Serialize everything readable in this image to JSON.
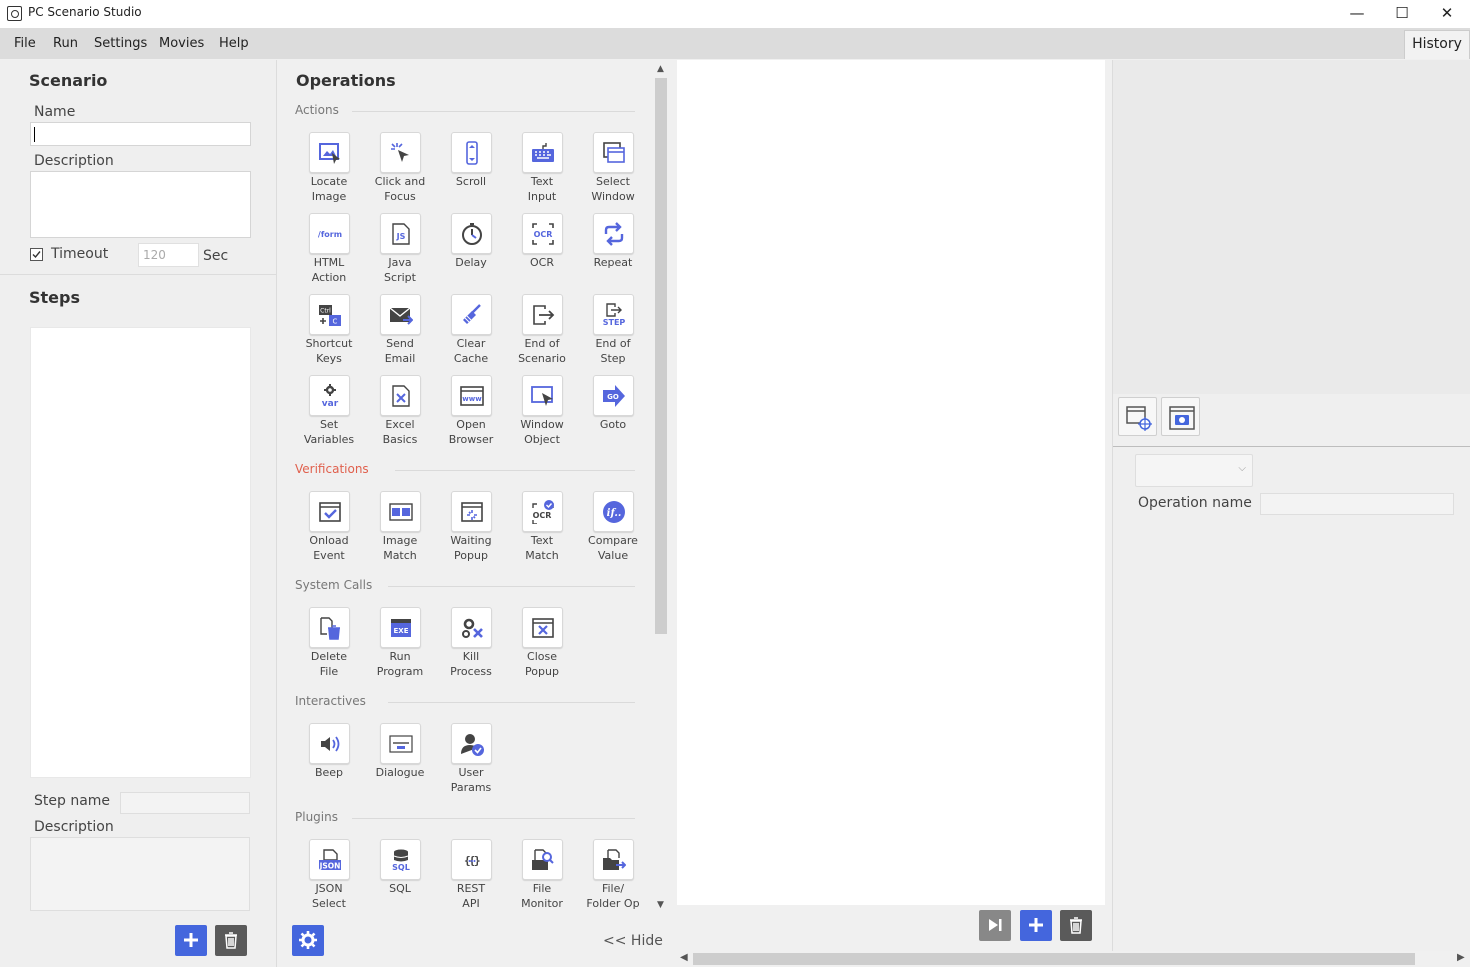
{
  "app": {
    "title": "PC Scenario Studio"
  },
  "window_controls": {
    "minimize": "—",
    "maximize": "☐",
    "close": "✕"
  },
  "menu": [
    "File",
    "Run",
    "Settings",
    "Movies",
    "Help"
  ],
  "history_tab": "History",
  "scenario": {
    "title": "Scenario",
    "name_label": "Name",
    "name_value": "",
    "description_label": "Description",
    "description_value": "",
    "timeout_label": "Timeout",
    "timeout_checked": true,
    "timeout_value": "120",
    "timeout_unit": "Sec"
  },
  "steps": {
    "title": "Steps",
    "step_name_label": "Step name",
    "step_name_value": "",
    "description_label": "Description",
    "description_value": ""
  },
  "operations": {
    "title": "Operations",
    "categories": [
      {
        "name": "Actions",
        "items": [
          {
            "label": "Locate\nImage",
            "icon": "locate-image-icon"
          },
          {
            "label": "Click and\nFocus",
            "icon": "click-focus-icon"
          },
          {
            "label": "Scroll",
            "icon": "scroll-icon"
          },
          {
            "label": "Text\nInput",
            "icon": "keyboard-icon"
          },
          {
            "label": "Select\nWindow",
            "icon": "select-window-icon"
          },
          {
            "label": "HTML\nAction",
            "icon": "html-form-icon"
          },
          {
            "label": "Java\nScript",
            "icon": "javascript-icon"
          },
          {
            "label": "Delay",
            "icon": "stopwatch-icon"
          },
          {
            "label": "OCR",
            "icon": "ocr-icon"
          },
          {
            "label": "Repeat",
            "icon": "repeat-icon"
          },
          {
            "label": "Shortcut\nKeys",
            "icon": "shortcut-keys-icon"
          },
          {
            "label": "Send\nEmail",
            "icon": "send-email-icon"
          },
          {
            "label": "Clear\nCache",
            "icon": "broom-icon"
          },
          {
            "label": "End of\nScenario",
            "icon": "exit-icon"
          },
          {
            "label": "End of\nStep",
            "icon": "end-step-icon"
          },
          {
            "label": "Set\nVariables",
            "icon": "variable-gear-icon"
          },
          {
            "label": "Excel\nBasics",
            "icon": "excel-icon"
          },
          {
            "label": "Open\nBrowser",
            "icon": "browser-www-icon"
          },
          {
            "label": "Window\nObject",
            "icon": "window-cursor-icon"
          },
          {
            "label": "Goto",
            "icon": "goto-arrow-icon"
          }
        ]
      },
      {
        "name": "Verifications",
        "items": [
          {
            "label": "Onload\nEvent",
            "icon": "onload-check-icon"
          },
          {
            "label": "Image\nMatch",
            "icon": "image-match-icon"
          },
          {
            "label": "Waiting\nPopup",
            "icon": "waiting-popup-icon"
          },
          {
            "label": "Text\nMatch",
            "icon": "ocr-check-icon"
          },
          {
            "label": "Compare\nValue",
            "icon": "compare-if-icon"
          }
        ]
      },
      {
        "name": "System Calls",
        "items": [
          {
            "label": "Delete\nFile",
            "icon": "delete-file-icon"
          },
          {
            "label": "Run\nProgram",
            "icon": "exe-icon"
          },
          {
            "label": "Kill\nProcess",
            "icon": "kill-process-icon"
          },
          {
            "label": "Close\nPopup",
            "icon": "close-popup-icon"
          }
        ]
      },
      {
        "name": "Interactives",
        "items": [
          {
            "label": "Beep",
            "icon": "speaker-icon"
          },
          {
            "label": "Dialogue",
            "icon": "dialog-box-icon"
          },
          {
            "label": "User\nParams",
            "icon": "user-check-icon"
          }
        ]
      },
      {
        "name": "Plugins",
        "items": [
          {
            "label": "JSON\nSelect",
            "icon": "json-icon"
          },
          {
            "label": "SQL",
            "icon": "database-icon"
          },
          {
            "label": "REST\nAPI",
            "icon": "rest-braces-icon"
          },
          {
            "label": "File\nMonitor",
            "icon": "file-monitor-icon"
          },
          {
            "label": "File/\nFolder Op",
            "icon": "file-folder-op-icon"
          }
        ]
      }
    ],
    "hide_label": "<< Hide"
  },
  "properties": {
    "operation_name_label": "Operation name",
    "operation_name_value": "",
    "select_value": ""
  },
  "colors": {
    "accent": "#4466dd",
    "ops_icon": "#5566dd",
    "verifications": "#e0604d"
  }
}
